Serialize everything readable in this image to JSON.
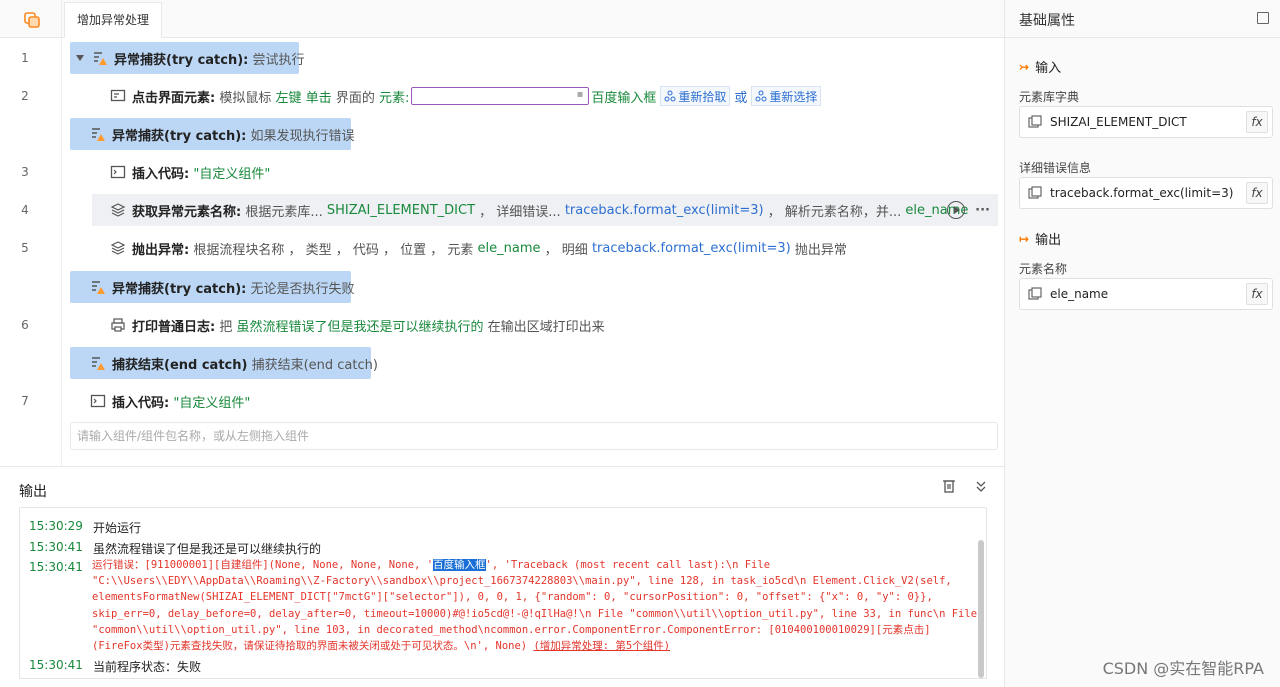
{
  "tab": {
    "label": "增加异常处理"
  },
  "editor": {
    "line_numbers": [
      "1",
      "2",
      "3",
      "4",
      "5",
      "6",
      "7"
    ],
    "rows": {
      "try1": {
        "kw": "异常捕获(try catch):",
        "desc": "尝试执行"
      },
      "click": {
        "kw": "点击界面元素:",
        "t1": "模拟鼠标",
        "t2": "左键",
        "t3": "单击",
        "t4": "界面的",
        "t5": "元素:",
        "target": "百度输入框",
        "btn1": "重新拾取",
        "or": "或",
        "btn2": "重新选择"
      },
      "try2": {
        "kw": "异常捕获(try catch):",
        "desc": "如果发现执行错误"
      },
      "code1": {
        "kw": "插入代码:",
        "val": "\"自定义组件\""
      },
      "getname": {
        "kw": "获取异常元素名称:",
        "t1": "根据元素库...",
        "v1": "SHIZAI_ELEMENT_DICT",
        "t2": "， 详细错误...",
        "v2": "traceback.format_exc(limit=3)",
        "t3": "， 解析元素名称，并...",
        "v3": "ele_name"
      },
      "throw": {
        "kw": "抛出异常:",
        "t1": "根据流程块名称 ， 类型 ， 代码 ， 位置 ， 元素",
        "v1": "ele_name",
        "t2": "， 明细",
        "v2": "traceback.format_exc(limit=3)",
        "t3": "抛出异常"
      },
      "try3": {
        "kw": "异常捕获(try catch):",
        "desc": "无论是否执行失败"
      },
      "print": {
        "kw": "打印普通日志:",
        "t1": "把",
        "v1": "虽然流程错误了但是我还是可以继续执行的",
        "t2": "在输出区域打印出来"
      },
      "endtry": {
        "kw": "捕获结束(end catch)",
        "desc": "捕获结束(end catch)"
      },
      "code2": {
        "kw": "插入代码:",
        "val": "\"自定义组件\""
      }
    },
    "add_placeholder": "请输入组件/组件包名称，或从左侧拖入组件"
  },
  "output": {
    "title": "输出",
    "logs": [
      {
        "time": "15:30:29",
        "text": "开始运行"
      },
      {
        "time": "15:30:41",
        "text": "虽然流程错误了但是我还是可以继续执行的"
      },
      {
        "time": "15:30:41",
        "text": ""
      },
      {
        "time": "15:30:41",
        "text": "当前程序状态：失败"
      }
    ],
    "error": {
      "prefix": "运行错误：[911000001][自建组件](None, None, None, None, '",
      "highlight": "百度输入框",
      "body": "', 'Traceback (most recent call last):\\n  File \"C:\\\\Users\\\\EDY\\\\AppData\\\\Roaming\\\\Z-Factory\\\\sandbox\\\\project_1667374228803\\\\main.py\", line 128, in task_io5cd\\n    Element.Click_V2(self, elementsFormatNew(SHIZAI_ELEMENT_DICT[\"7mctG\"][\"selector\"]), 0, 0, 1, {\"random\": 0, \"cursorPosition\": 0, \"offset\": {\"x\": 0, \"y\": 0}}, skip_err=0, delay_before=0, delay_after=0, timeout=10000)#@!io5cd@!-@!qIlHa@!\\n  File \"common\\\\util\\\\option_util.py\", line 33, in func\\n  File \"common\\\\util\\\\option_util.py\", line 103, in decorated_method\\ncommon.error.ComponentError.ComponentError: [010400100010029][元素点击](FireFox类型)元素查找失败，请保证待拾取的界面未被关闭或处于可见状态。\\n', None) ",
      "link": "(增加异常处理: 第5个组件)"
    }
  },
  "props": {
    "title": "基础属性",
    "input_section": "输入",
    "output_section": "输出",
    "fields": [
      {
        "label": "元素库字典",
        "value": "SHIZAI_ELEMENT_DICT"
      },
      {
        "label": "详细错误信息",
        "value": "traceback.format_exc(limit=3)"
      },
      {
        "label": "元素名称",
        "value": "ele_name"
      }
    ],
    "fx": "fx"
  },
  "watermark": "CSDN @实在智能RPA",
  "colors": {
    "block": "#bcd7f5",
    "keyword_blue": "#2d6fd1",
    "value_green": "#19893c",
    "error_red": "#e3352b",
    "accent_orange": "#ff7a00"
  }
}
